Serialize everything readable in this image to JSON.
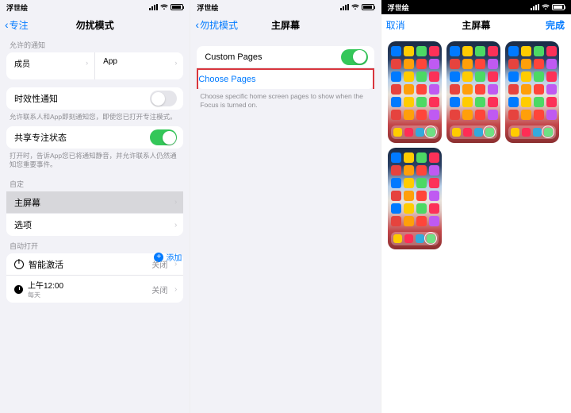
{
  "status": {
    "carrier": "浮世绘"
  },
  "p1": {
    "back": "专注",
    "title": "勿扰模式",
    "sec_allowed": "允许的通知",
    "col_members": "成员",
    "col_app": "App",
    "time_sensitive": "时效性通知",
    "time_foot": "允许联系人和App即刻通知您，即使您已打开专注模式。",
    "share": "共享专注状态",
    "share_foot": "打开时，告诉App您已将通知静音，并允许联系人仍然通知您重要事件。",
    "custom": "自定",
    "home": "主屏幕",
    "options": "选项",
    "auto": "自动打开",
    "add": "添加",
    "smart": "智能激活",
    "smart_val": "关闭",
    "time": "上午12:00",
    "time_sub": "每天",
    "time_val": "关闭"
  },
  "p2": {
    "back": "勿扰模式",
    "title": "主屏幕",
    "custom_pages": "Custom Pages",
    "choose": "Choose Pages",
    "foot": "Choose specific home screen pages to show when the Focus is turned on."
  },
  "p3": {
    "cancel": "取消",
    "title": "主屏幕",
    "done": "完成"
  },
  "appColors": [
    "#35c759",
    "#ff3b30",
    "#007aff",
    "#ff9500",
    "#5856d6",
    "#ffcc00",
    "#ff2d55",
    "#34aadc",
    "#4cd964",
    "#ff6482",
    "#1ca0dc",
    "#fc3158",
    "#8e8e93",
    "#0b84ff",
    "#e6433e",
    "#2fb14f",
    "#ffffff",
    "#ff9f0a",
    "#32ade6",
    "#a2845e",
    "#ff453a",
    "#30d158",
    "#64d2ff",
    "#bf5af2"
  ]
}
